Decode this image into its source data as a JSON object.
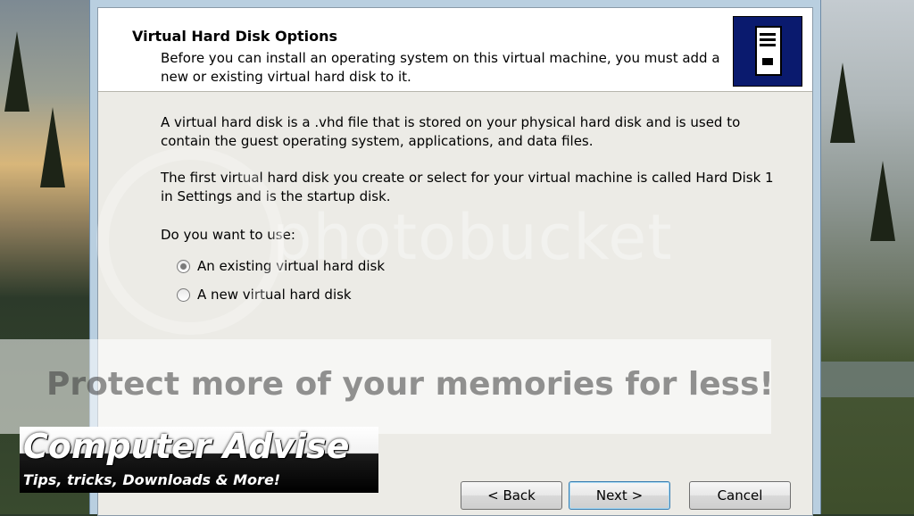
{
  "wizard": {
    "title": "Virtual Hard Disk Options",
    "subtitle": "Before you can install an operating system on this virtual machine, you must add a new or existing virtual hard disk to it.",
    "paragraph1": "A virtual hard disk is a .vhd file that is stored on your physical hard disk and is used to contain the guest operating system, applications, and data files.",
    "paragraph2": "The first virtual hard disk you create or select for your virtual machine is called Hard Disk 1 in Settings and is the startup disk.",
    "question": "Do you want to use:",
    "options": [
      {
        "label": "An existing virtual hard disk",
        "selected": true
      },
      {
        "label": "A new virtual hard disk",
        "selected": false
      }
    ],
    "buttons": {
      "back": "< Back",
      "next": "Next >",
      "cancel": "Cancel"
    },
    "header_icon": "server-tower-icon"
  },
  "watermark": {
    "logo": "photobucket",
    "banner": "Protect more of your memories for less!"
  },
  "branding": {
    "title": "Computer Advise",
    "tagline": "Tips, tricks, Downloads & More!"
  },
  "colors": {
    "header_icon_bg": "#0a1a6e",
    "dialog_bg": "#ecebe6",
    "default_button_border": "#3c7fb1"
  }
}
